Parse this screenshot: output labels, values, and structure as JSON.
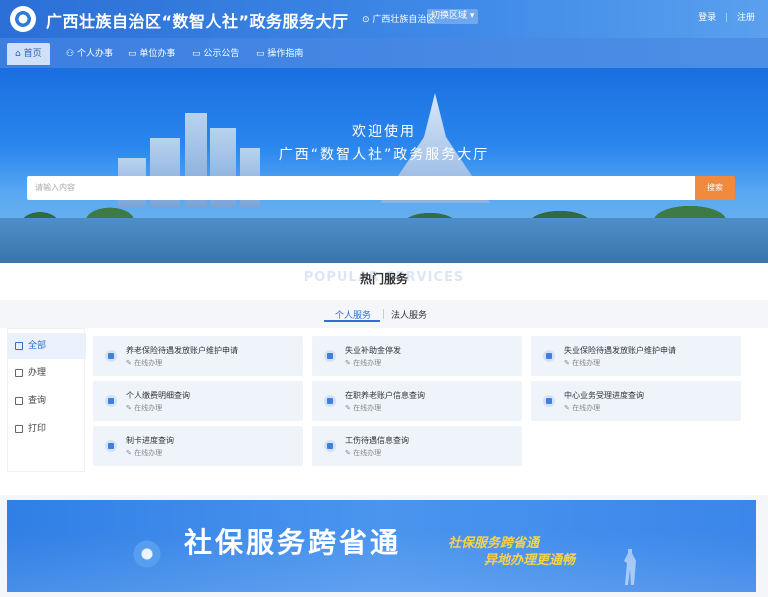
{
  "header": {
    "title": "广西壮族自治区“数智人社”政务服务大厅",
    "region": "广西壮族自治区",
    "switch_region": "切换区域",
    "login": "登录",
    "divider": "|",
    "register": "注册"
  },
  "nav": {
    "items": [
      {
        "label": "首页",
        "icon": "home-icon"
      },
      {
        "label": "个人办事",
        "icon": "person-icon"
      },
      {
        "label": "单位办事",
        "icon": "briefcase-icon"
      },
      {
        "label": "公示公告",
        "icon": "notice-icon"
      },
      {
        "label": "操作指南",
        "icon": "guide-icon"
      }
    ]
  },
  "hero": {
    "welcome": "欢迎使用",
    "hall": "广西“数智人社”政务服务大厅",
    "search_placeholder": "请输入内容",
    "search_button": "搜索"
  },
  "popular": {
    "title": "热门服务",
    "title_en": "POPULAR SERVICES",
    "tabs": [
      "个人服务",
      "法人服务"
    ]
  },
  "sidebar": {
    "items": [
      {
        "label": "全部",
        "icon": "grid-icon"
      },
      {
        "label": "办理",
        "icon": "edit-icon"
      },
      {
        "label": "查询",
        "icon": "search-icon"
      },
      {
        "label": "打印",
        "icon": "printer-icon"
      }
    ]
  },
  "services": [
    {
      "title": "养老保险待遇发放账户维护申请",
      "status": "在线办理"
    },
    {
      "title": "失业补助金停发",
      "status": "在线办理"
    },
    {
      "title": "失业保险待遇发放账户维护申请",
      "status": "在线办理"
    },
    {
      "title": "个人缴费明细查询",
      "status": "在线办理"
    },
    {
      "title": "在职养老账户信息查询",
      "status": "在线办理"
    },
    {
      "title": "中心业务受理进度查询",
      "status": "在线办理"
    },
    {
      "title": "制卡进度查询",
      "status": "在线办理"
    },
    {
      "title": "工伤待遇信息查询",
      "status": "在线办理"
    }
  ],
  "banner": {
    "title": "社保服务跨省通",
    "sub1": "社保服务跨省通",
    "sub2": "异地办理更通畅"
  },
  "colors": {
    "brand": "#2f6fd6",
    "search_button": "#f08a3e",
    "banner_accent": "#f7d24a"
  }
}
